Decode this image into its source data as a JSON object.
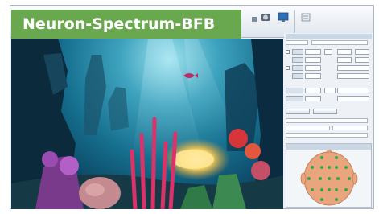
{
  "product": {
    "title": "Neuron-Spectrum-BFB"
  },
  "toolbar": {
    "buttons": [
      {
        "name": "record-button",
        "icon": "record-icon"
      },
      {
        "name": "monitor-button",
        "icon": "monitor-icon"
      },
      {
        "name": "settings-button",
        "icon": "settings-icon"
      }
    ]
  },
  "video": {
    "scene": "aquarium-biofeedback-video"
  },
  "panel": {
    "head_map": {
      "icon": "electrode-head-map-icon"
    }
  },
  "colors": {
    "badge": "#6aa84f",
    "badge_text": "#ffffff",
    "window_bg": "#eef2f7",
    "head_skin": "#e9a57e",
    "electrode": "#3aa34a"
  }
}
